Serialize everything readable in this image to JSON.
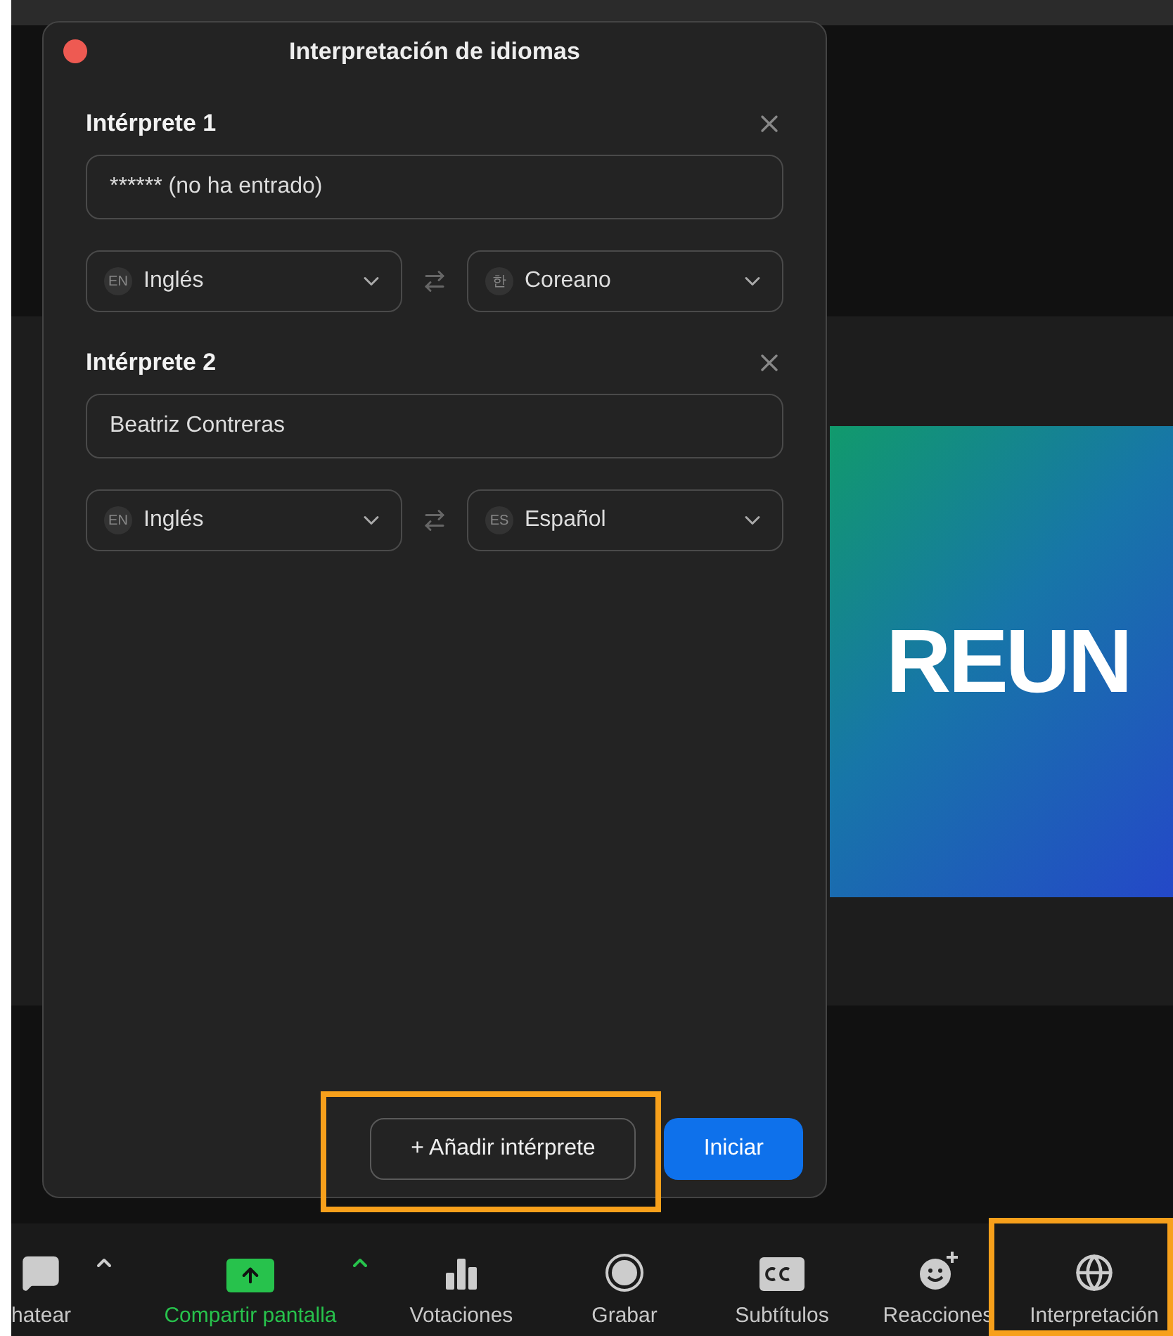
{
  "modal": {
    "title": "Interpretación de idiomas",
    "interpreters": [
      {
        "heading": "Intérprete 1",
        "name": "****** (no ha entrado)",
        "from": {
          "code": "EN",
          "language": "Inglés"
        },
        "to": {
          "code": "한",
          "language": "Coreano"
        }
      },
      {
        "heading": "Intérprete 2",
        "name": "Beatriz Contreras",
        "from": {
          "code": "EN",
          "language": "Inglés"
        },
        "to": {
          "code": "ES",
          "language": "Español"
        }
      }
    ],
    "add_button": "+ Añadir intérprete",
    "start_button": "Iniciar"
  },
  "slide": {
    "logo": "REUN"
  },
  "toolbar": [
    {
      "kind": "chat",
      "label": "hatear",
      "caret": true,
      "active": false
    },
    {
      "kind": "share",
      "label": "Compartir pantalla",
      "caret": true,
      "active": true
    },
    {
      "kind": "polls",
      "label": "Votaciones",
      "caret": false,
      "active": false
    },
    {
      "kind": "record",
      "label": "Grabar",
      "caret": false,
      "active": false
    },
    {
      "kind": "captions",
      "label": "Subtítulos",
      "caret": false,
      "active": false
    },
    {
      "kind": "reactions",
      "label": "Reacciones",
      "caret": false,
      "active": false
    },
    {
      "kind": "interpretation",
      "label": "Interpretación",
      "caret": false,
      "active": false
    }
  ]
}
